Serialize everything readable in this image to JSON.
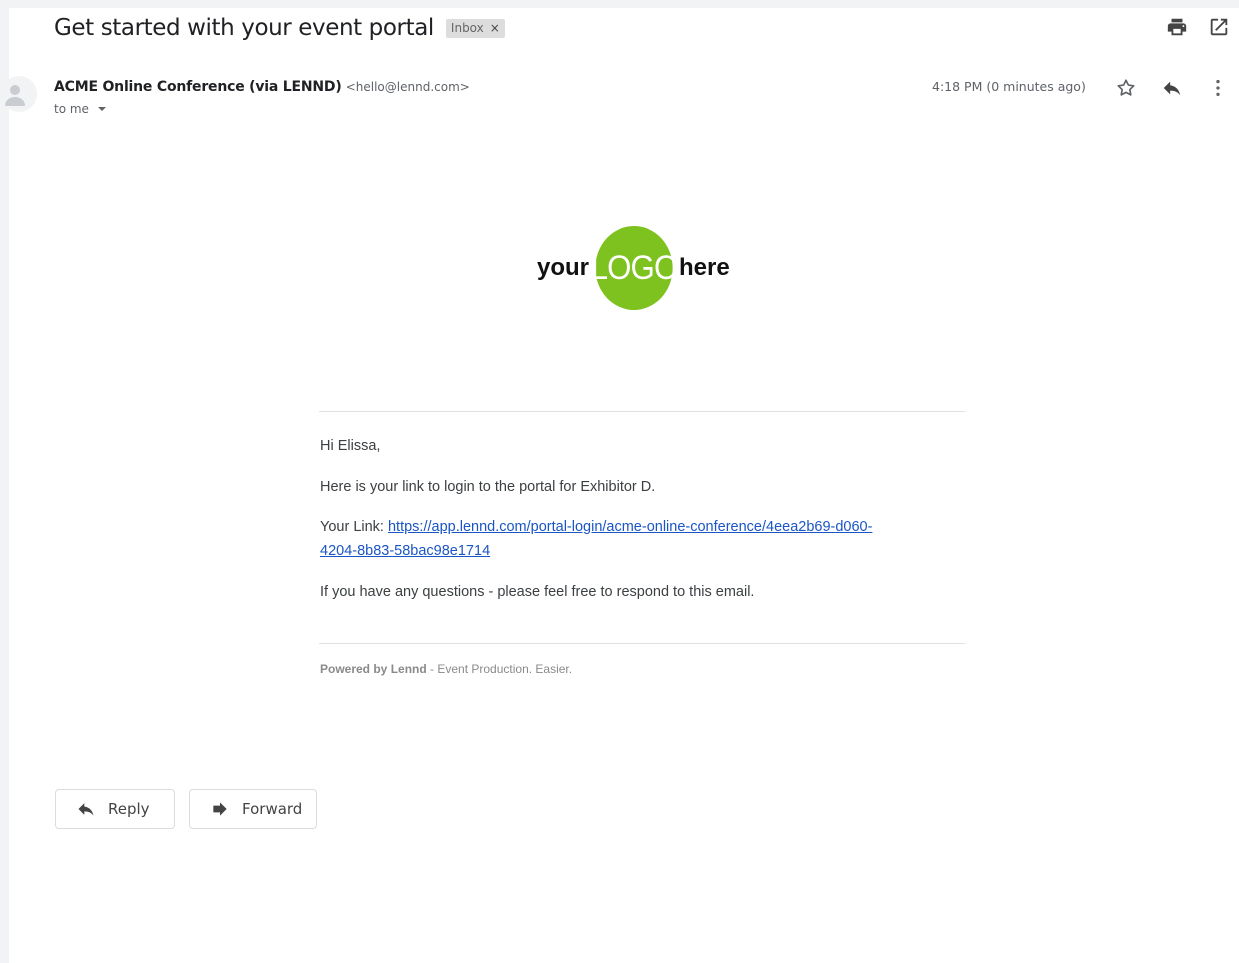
{
  "email": {
    "subject": "Get started with your event portal",
    "label": "Inbox",
    "label_close": "×",
    "sender_name": "ACME Online Conference (via LENND)",
    "sender_email": "<hello@lennd.com>",
    "recipient": "to me",
    "timestamp": "4:18 PM (0 minutes ago)"
  },
  "icons": {
    "print": "print-icon",
    "open_new_window": "open-in-new-window-icon",
    "star": "star-icon",
    "reply": "reply-icon",
    "more": "more-vertical-icon",
    "avatar": "person-icon"
  },
  "logo": {
    "left_word": "your",
    "center_word": "LOGO",
    "right_word": "here",
    "circle_color": "#7dc21e"
  },
  "message": {
    "greeting": "Hi Elissa,",
    "line1": "Here is your link to login to the portal for Exhibitor D.",
    "link_prefix": "Your Link: ",
    "link_line1": "https://app.lennd.com/portal-login/acme-online-conference/4eea2b69-d060-",
    "link_line2": "4204-8b83-58bac98e1714",
    "line3": "If you have any questions - please feel free to respond to this email.",
    "footer_bold": "Powered by Lennd",
    "footer_rest": " - Event Production. Easier."
  },
  "actions": {
    "reply": "Reply",
    "forward": "Forward"
  },
  "colors": {
    "link": "#1a55c6",
    "chip_bg": "#dddddd"
  }
}
